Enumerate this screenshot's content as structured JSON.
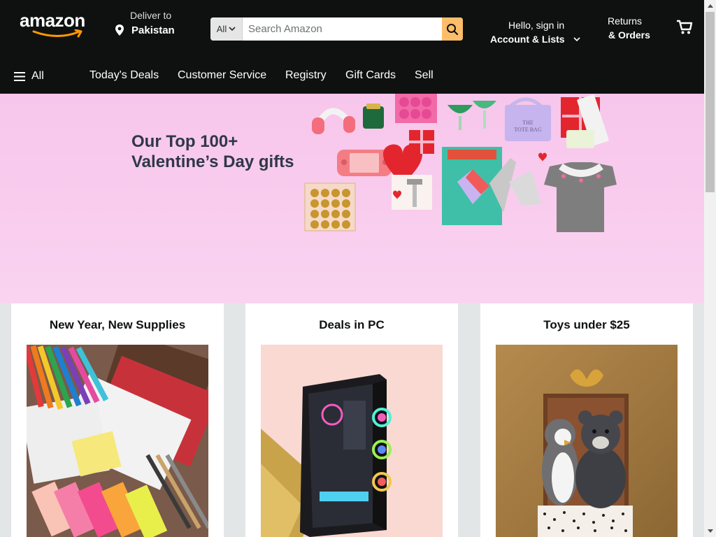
{
  "header": {
    "logo_text": "amazon",
    "deliver_to_label": "Deliver to",
    "deliver_to_location": "Pakistan",
    "search": {
      "category": "All",
      "placeholder": "Search Amazon"
    },
    "account_line1": "Hello, sign in",
    "account_line2": "Account & Lists",
    "returns_line1": "Returns",
    "returns_line2": "& Orders",
    "colors": {
      "nav_bg": "#0f1111",
      "search_button": "#febd69",
      "smile": "#f90"
    }
  },
  "subnav": {
    "all_label": "All",
    "links": [
      "Today's Deals",
      "Customer Service",
      "Registry",
      "Gift Cards",
      "Sell"
    ]
  },
  "hero": {
    "title_line1": "Our Top 100+",
    "title_line2": "Valentine’s Day gifts",
    "background": "#f7c6ec"
  },
  "cards": [
    {
      "title": "New Year, New Supplies"
    },
    {
      "title": "Deals in PC"
    },
    {
      "title": "Toys under $25"
    }
  ]
}
